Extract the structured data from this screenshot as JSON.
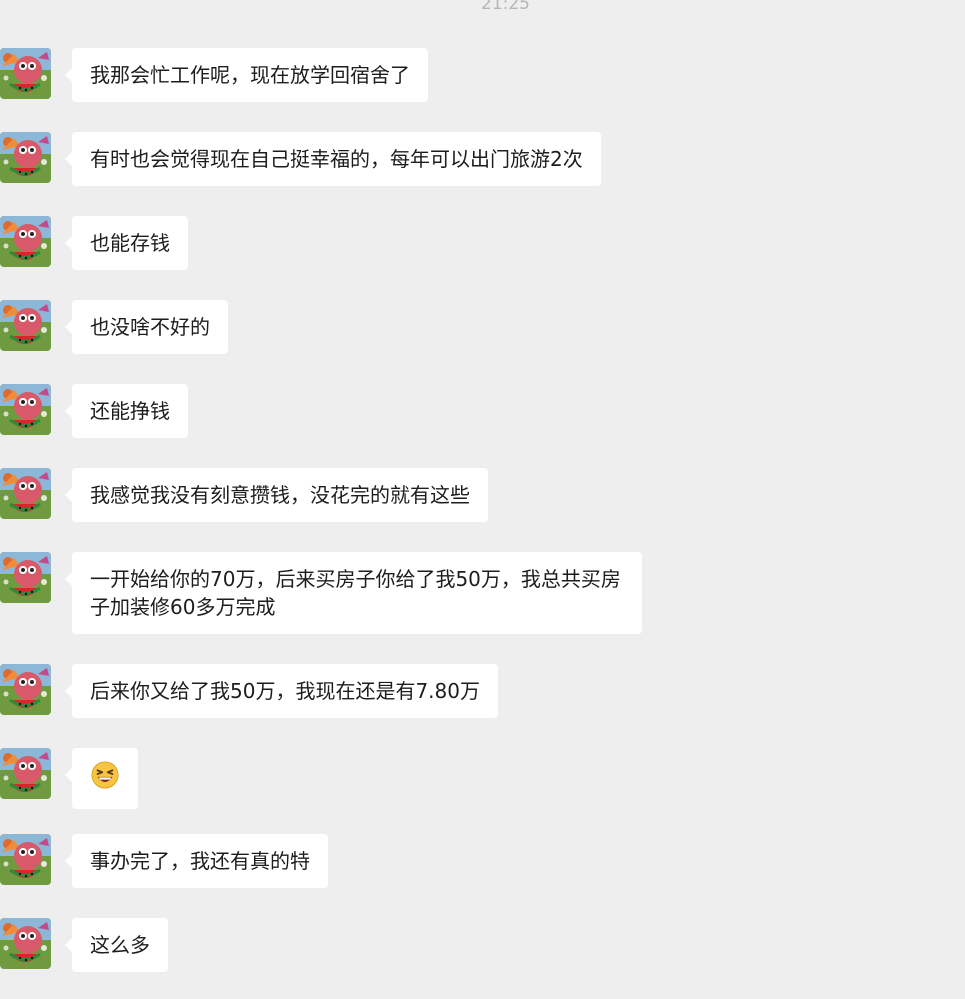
{
  "chat": {
    "timestamp": "21:25",
    "messages": [
      {
        "text": "我那会忙工作呢，现在放学回宿舍了"
      },
      {
        "text": "有时也会觉得现在自己挺幸福的，每年可以出门旅游2次"
      },
      {
        "text": "也能存钱"
      },
      {
        "text": "也没啥不好的"
      },
      {
        "text": "还能挣钱"
      },
      {
        "text": "我感觉我没有刻意攒钱，没花完的就有这些"
      },
      {
        "text": "一开始给你的70万，后来买房子你给了我50万，我总共买房子加装修60多万完成"
      },
      {
        "text": "后来你又给了我50万，我现在还是有7.80万"
      },
      {
        "emoji": "grinning-squint-face"
      },
      {
        "text": "事办完了，我还有真的特"
      },
      {
        "text": "这么多"
      }
    ]
  },
  "colors": {
    "background": "#eeeeee",
    "bubble": "#ffffff",
    "text": "#1d1d1d",
    "timestamp": "#b6b6b6",
    "emoji_yellow": "#f7c542"
  }
}
